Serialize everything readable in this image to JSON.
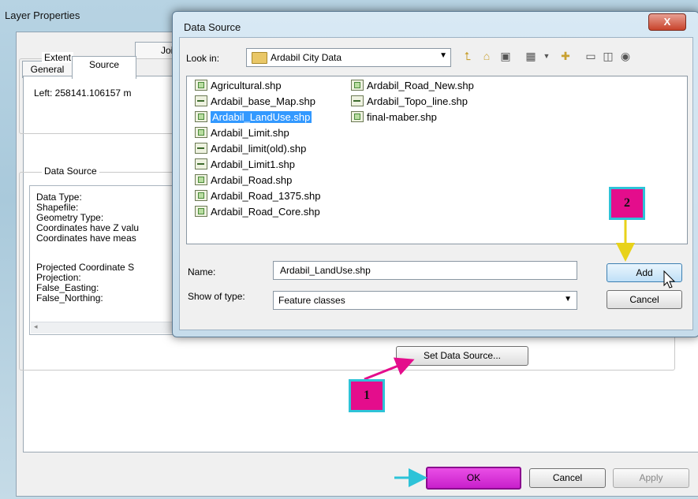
{
  "layer_properties": {
    "title": "Layer Properties",
    "tabs": {
      "general": "General",
      "source": "Source",
      "joins": "Joins"
    },
    "extent": {
      "label": "Extent",
      "left_text": "Left: 258141.106157 m"
    },
    "data_source": {
      "label": "Data Source",
      "lines": [
        "Data Type:",
        "Shapefile:",
        "Geometry Type:",
        "Coordinates have Z valu",
        "Coordinates have meas",
        "",
        "Projected Coordinate S",
        "Projection:",
        "False_Easting:",
        "False_Northing:"
      ]
    },
    "set_data_source_label": "Set Data Source...",
    "ok_label": "OK",
    "cancel_label": "Cancel",
    "apply_label": "Apply"
  },
  "dialog": {
    "title": "Data Source",
    "close_label": "X",
    "look_in_label": "Look in:",
    "look_in_value": "Ardabil City Data",
    "files_col1": [
      {
        "name": "Agricultural.shp",
        "icon": "poly"
      },
      {
        "name": "Ardabil_base_Map.shp",
        "icon": "line"
      },
      {
        "name": "Ardabil_LandUse.shp",
        "icon": "poly"
      },
      {
        "name": "Ardabil_Limit.shp",
        "icon": "poly"
      },
      {
        "name": "Ardabil_limit(old).shp",
        "icon": "line"
      },
      {
        "name": "Ardabil_Limit1.shp",
        "icon": "line"
      },
      {
        "name": "Ardabil_Road.shp",
        "icon": "poly"
      },
      {
        "name": "Ardabil_Road_1375.shp",
        "icon": "poly"
      },
      {
        "name": "Ardabil_Road_Core.shp",
        "icon": "poly"
      }
    ],
    "files_col2": [
      {
        "name": "Ardabil_Road_New.shp",
        "icon": "poly"
      },
      {
        "name": "Ardabil_Topo_line.shp",
        "icon": "line"
      },
      {
        "name": "final-maber.shp",
        "icon": "poly"
      }
    ],
    "name_label": "Name:",
    "name_value": "Ardabil_LandUse.shp",
    "show_type_label": "Show of type:",
    "show_type_value": "Feature classes",
    "add_label": "Add",
    "cancel_label": "Cancel"
  },
  "annotations": {
    "marker_1": "1",
    "marker_2": "2",
    "accent": "#e40d8c",
    "border": "#2ec3d8"
  }
}
